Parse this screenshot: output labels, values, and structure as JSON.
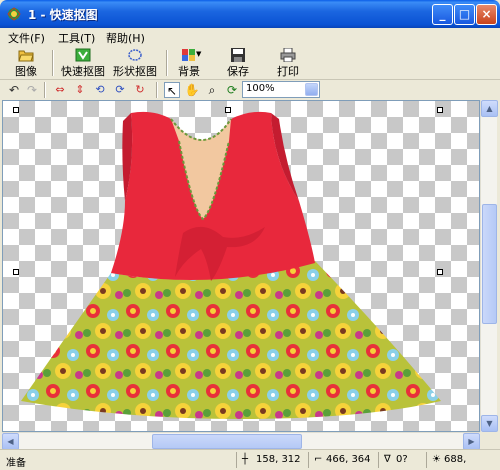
{
  "window": {
    "title": "1 - 快速抠图",
    "buttons": {
      "minimize": "_",
      "maximize": "□",
      "close": "×"
    }
  },
  "menu": [
    {
      "label": "文件(F)"
    },
    {
      "label": "工具(T)"
    },
    {
      "label": "帮助(H)"
    }
  ],
  "toolbar": [
    {
      "label": "图像",
      "icon": "open-folder-icon"
    },
    {
      "label": "快速抠图",
      "icon": "quick-cutout-icon"
    },
    {
      "label": "形状抠图",
      "icon": "shape-cutout-icon"
    },
    {
      "label": "背景",
      "icon": "background-icon"
    },
    {
      "label": "保存",
      "icon": "save-icon"
    },
    {
      "label": "打印",
      "icon": "print-icon"
    }
  ],
  "toolbar2": {
    "zoom_value": "100%"
  },
  "status": {
    "text": "准备",
    "cursor": "158, 312",
    "size": "466, 364",
    "angle": "0?",
    "extra": "688,"
  },
  "colors": {
    "title_bar": "#0a52d4",
    "dress_red": "#e8283c",
    "checker": "#c8c8c8"
  }
}
